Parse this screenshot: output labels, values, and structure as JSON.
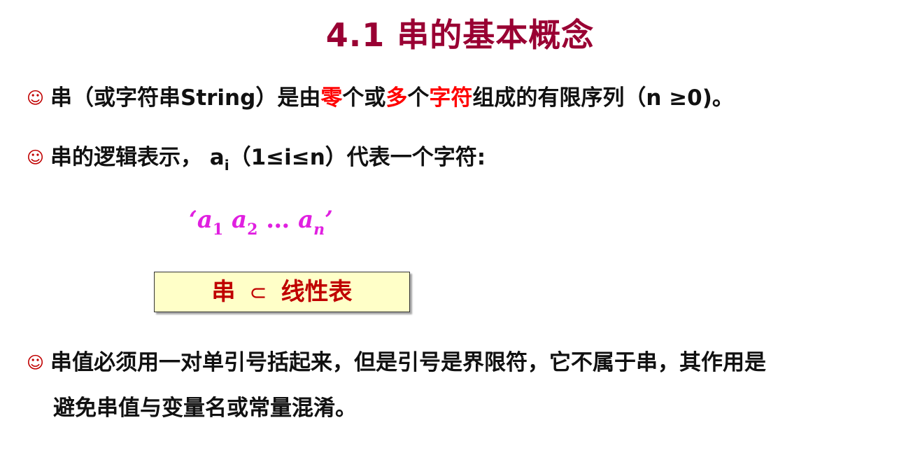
{
  "title": "4.1 串的基本概念",
  "bullet_icon": "☺",
  "bullet1": {
    "p1": "串（或字符串String）是由",
    "h1": "零",
    "p2": "个或",
    "h2": "多",
    "p3": "个",
    "h3": "字符",
    "p4": "组成的有限序列（n ≥0)。"
  },
  "bullet2": {
    "p1": "串的逻辑表示，  a",
    "sub": "i",
    "p2": "（1≤i≤n）代表一个字符:"
  },
  "formula": {
    "open_quote": "‘",
    "a1": "a",
    "s1": "1",
    "a2": "a",
    "s2": "2",
    "dots": "…",
    "an": "a",
    "sn": "n",
    "close_quote": "’"
  },
  "subset_box": {
    "left": "串",
    "op": "⊂",
    "right": "线性表"
  },
  "bullet3": {
    "line1": "串值必须用一对单引号括起来，但是引号是界限符，它不属于串，其作用是",
    "line2": "避免串值与变量名或常量混淆。"
  },
  "colors": {
    "title": "#990033",
    "highlight": "#ff0000",
    "formula": "#e020e0",
    "box_bg": "#ffffc8",
    "box_text": "#c00000"
  }
}
